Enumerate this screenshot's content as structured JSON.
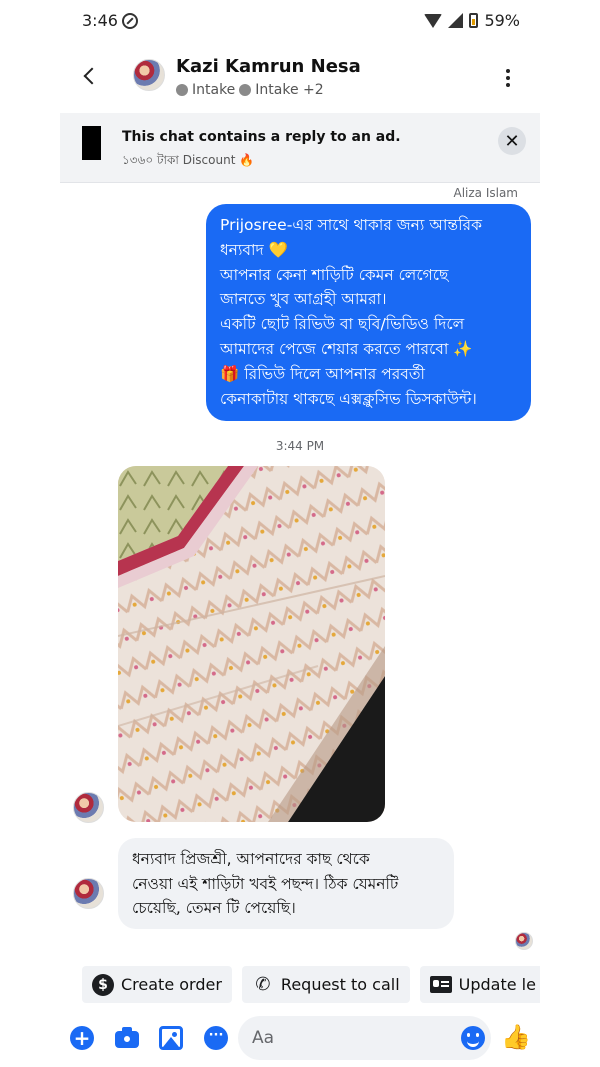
{
  "status_bar": {
    "time": "3:46",
    "battery": "59%"
  },
  "header": {
    "contact_name": "Kazi Kamrun Nesa",
    "tags": [
      "Intake",
      "Intake +2"
    ]
  },
  "ad_banner": {
    "title": "This chat contains a reply to an ad.",
    "subtitle": "১৩৬০ টাকা Discount 🔥",
    "close_label": "✕"
  },
  "conversation": {
    "sender_name": "Aliza Islam",
    "outgoing_message_lines": [
      "Prijosree-এর সাথে থাকার জন্য আন্তরিক",
      "ধন্যবাদ 💛",
      "আপনার কেনা শাড়িটি কেমন লেগেছে",
      "জানতে খুব আগ্রহী আমরা।",
      "একটি ছোট রিভিউ বা ছবি/ভিডিও দিলে",
      "আমাদের পেজে শেয়ার করতে পারবো ✨",
      "🎁 রিভিউ দিলে আপনার পরবর্তী",
      "কেনাকাটায় থাকছে এক্সক্লুসিভ ডিসকাউন্ট।"
    ],
    "timestamp": "3:44 PM",
    "incoming_message_lines": [
      "ধন্যবাদ প্রিজশ্রী, আপনাদের কাছ থেকে",
      "নেওয়া এই শাড়িটা  খবই পছন্দ। ঠিক যেমনটি",
      "চেয়েছি, তেমন টি পেয়েছি।"
    ]
  },
  "quick_actions": [
    {
      "label": "Create order",
      "icon": "dollar-circle-icon"
    },
    {
      "label": "Request to call",
      "icon": "phone-plus-icon"
    },
    {
      "label": "Update le",
      "icon": "contact-card-icon"
    }
  ],
  "composer": {
    "placeholder": "Aa",
    "accent_color": "#1a6af4"
  }
}
